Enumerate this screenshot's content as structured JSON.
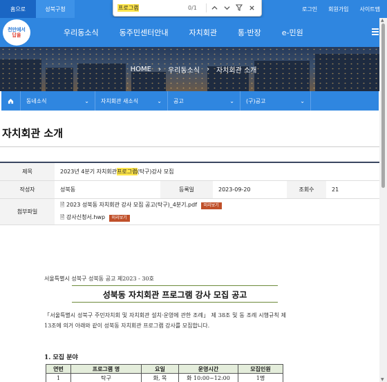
{
  "topbar": {
    "home_tab": "홈으로",
    "district_tab": "성북구청",
    "links": [
      "로그인",
      "회원가입",
      "사이트맵"
    ]
  },
  "findbar": {
    "query": "프로그램",
    "count": "0/1",
    "icons": [
      "chevron-up-icon",
      "chevron-down-icon",
      "filter-icon",
      "close-icon"
    ]
  },
  "logo": {
    "line1": "천만에서",
    "line2": "답을"
  },
  "nav": {
    "items": [
      "우리동소식",
      "동주민센터안내",
      "자치회관",
      "통·반장",
      "e-민원"
    ]
  },
  "hero": {
    "crumbs": [
      "HOME",
      "우리동소식",
      "자치회관 소개"
    ]
  },
  "subnav": {
    "selects": [
      "동네소식",
      "자치회관 새소식",
      "공고",
      "(구)공고"
    ]
  },
  "page": {
    "title": "자치회관 소개"
  },
  "post": {
    "subject_label": "제목",
    "subject_pre": "2023년 4분기 자치회관 ",
    "subject_highlight": "프로그램",
    "subject_post": "(탁구)강사 모집",
    "author_label": "작성자",
    "author": "성북동",
    "date_label": "등록일",
    "date": "2023-09-20",
    "views_label": "조회수",
    "views": "21",
    "attach_label": "첨부파일",
    "attachments": [
      {
        "name": "2023 성북동 자치회관 강사 모집 공고(탁구)_4분기.pdf",
        "button": "미리보기"
      },
      {
        "name": "강사신청서.hwp",
        "button": "미리보기"
      }
    ]
  },
  "doc": {
    "meta": "서울특별시 성북구 성북동 공고 제2023 - 30호",
    "headline": "성북동 자치회관 프로그램 강사 모집 공고",
    "para": "「서울특별시 성북구 주민자치회 및 자치회관 설치·운영에 관한 조례」 제 38조 및 동 조례 시행규칙 제13조에 의거 아래와 같이 성북동 자치회관 프로그램 강사를 모집합니다.",
    "section": "1. 모집 분야",
    "table": {
      "headers": [
        "연번",
        "프로그램 명",
        "요일",
        "운영시간",
        "모집인원"
      ],
      "rows": [
        [
          "1",
          "탁구",
          "화, 목",
          "화 10:00~12:00",
          "1명"
        ]
      ]
    }
  }
}
